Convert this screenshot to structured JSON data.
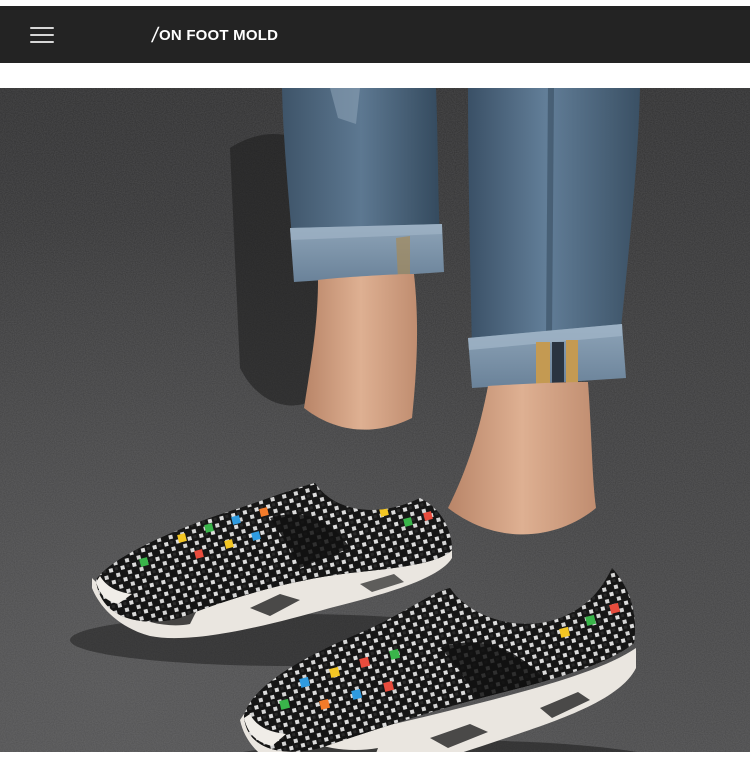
{
  "header": {
    "title_slash": "/",
    "title": "ON FOOT MOLD",
    "menu_icon": "hamburger-menu-icon",
    "background_color": "#232323",
    "text_color": "#ffffff"
  },
  "main": {
    "product_image": {
      "alt": "",
      "colors": {
        "asphalt": "#3a3a3b",
        "denim": "#4f6780",
        "upper": "#161616",
        "sole": "#ece9e4"
      }
    }
  }
}
